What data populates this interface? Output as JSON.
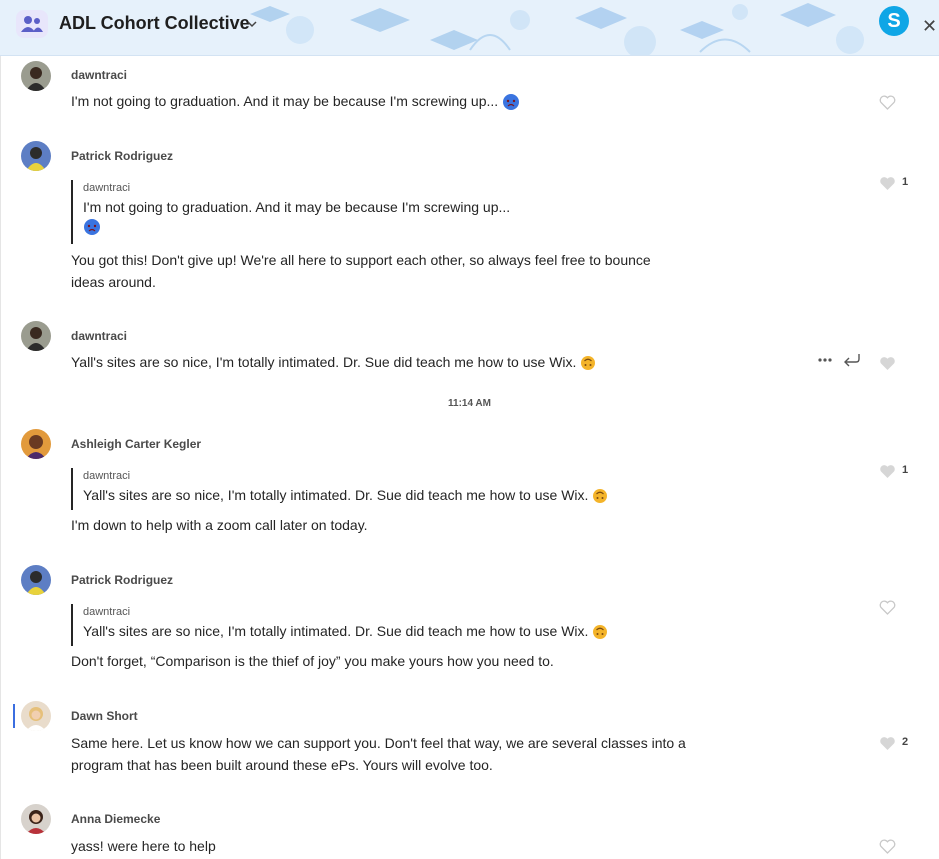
{
  "header": {
    "title": "ADL Cohort Collective",
    "skype_letter": "S",
    "close_symbol": "✕"
  },
  "timestamp": "11:14 AM",
  "messages": [
    {
      "author": "dawntraci",
      "text": "I'm not going to graduation. And it may be because I'm screwing up...",
      "emoji": "face-emoji",
      "likes": ""
    },
    {
      "author": "Patrick Rodriguez",
      "quote_author": "dawntraci",
      "quote_text": "I'm not going to graduation. And it may be because I'm screwing up...",
      "text_line1": "You got this! Don't give up! We're all here to support each other, so always feel free to bounce",
      "text_line2": "ideas around.",
      "likes": "1"
    },
    {
      "author": "dawntraci",
      "text": "Yall's sites are so nice, I'm totally intimated. Dr. Sue did teach me how to use Wix.",
      "likes": ""
    },
    {
      "author": "Ashleigh Carter Kegler",
      "quote_author": "dawntraci",
      "quote_text": "Yall's sites are so nice, I'm totally intimated. Dr. Sue did teach me how to use Wix.",
      "text": "I'm down to help with a zoom call later on today.",
      "likes": "1"
    },
    {
      "author": "Patrick Rodriguez",
      "quote_author": "dawntraci",
      "quote_text": "Yall's sites are so nice, I'm totally intimated. Dr. Sue did teach me how to use Wix.",
      "text": "Don't forget, “Comparison is the thief of joy” you make yours how you need to.",
      "likes": ""
    },
    {
      "author": "Dawn Short",
      "text_line1": "Same here. Let us know how we can support you. Don't feel that way, we are several classes into a",
      "text_line2": "program that has been built around these ePs. Yours will evolve too.",
      "likes": "2"
    },
    {
      "author": "Anna Diemecke",
      "text": "yass! were here to help",
      "likes": ""
    }
  ],
  "actions": {
    "more_icon": "more-icon",
    "reply_icon": "reply-icon"
  }
}
